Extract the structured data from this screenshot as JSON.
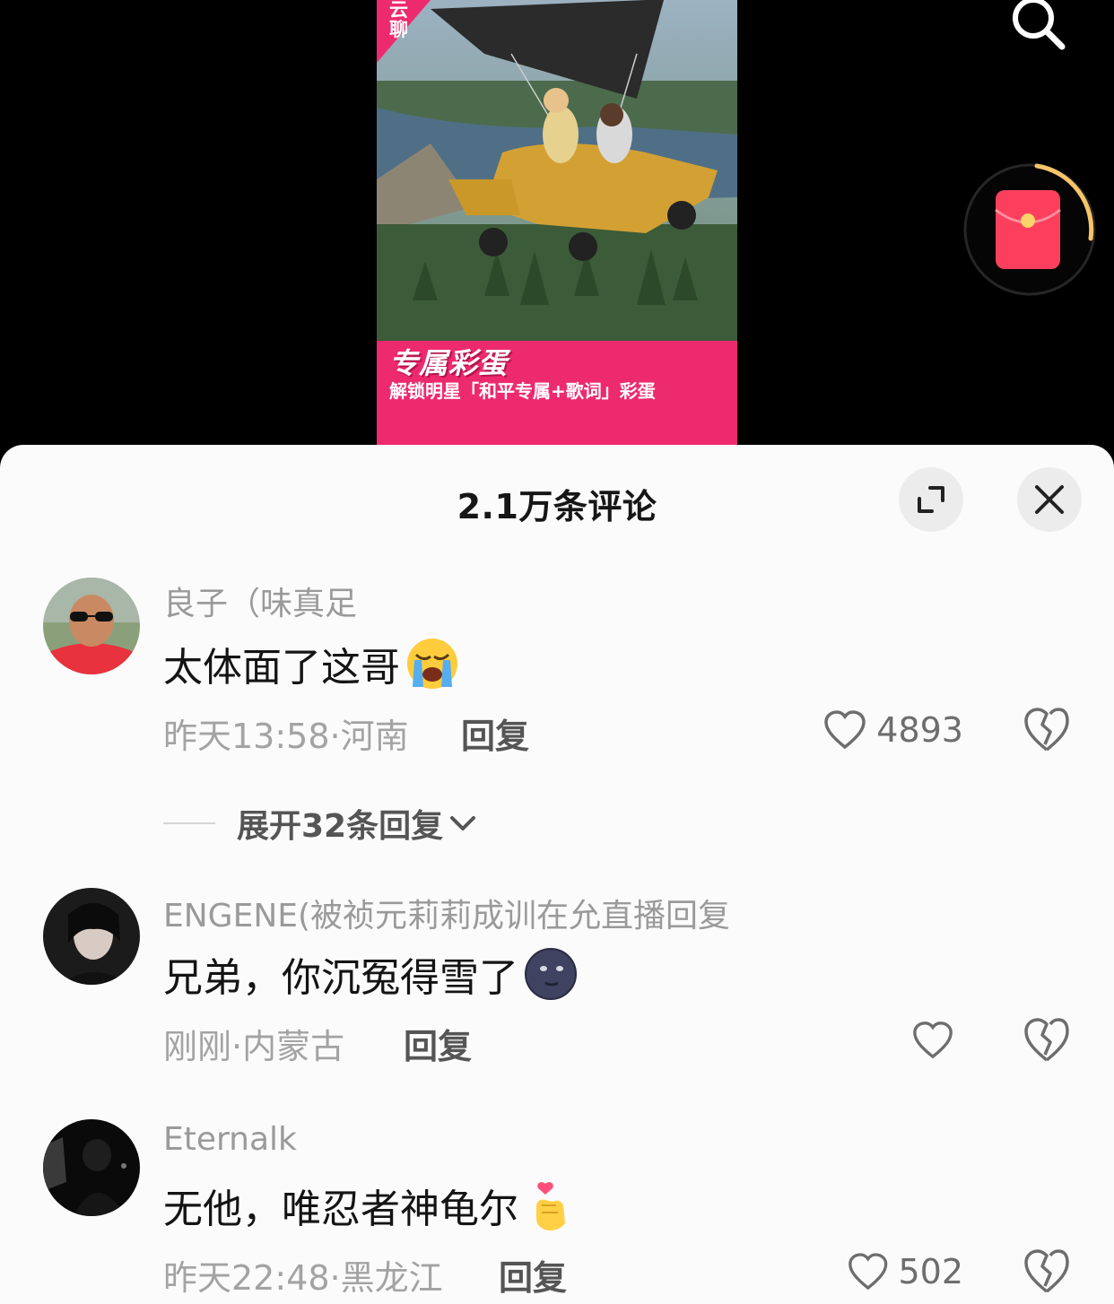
{
  "video": {
    "poster_logo": "云聊",
    "poster_title": "专属彩蛋",
    "poster_subtitle": "解锁明星「和平专属+歌词」彩蛋",
    "search_icon": "search-icon",
    "redpacket_icon": "red-envelope-icon"
  },
  "comments_panel": {
    "title": "2.1万条评论",
    "expand_icon": "expand-icon",
    "close_icon": "close-icon",
    "comments": [
      {
        "username": "良子（味真足",
        "text": "太体面了这哥",
        "emoji": "loudly-crying-face",
        "meta": "昨天13:58·河南",
        "reply_label": "回复",
        "likes": "4893",
        "expand_replies": "展开32条回复"
      },
      {
        "username": "ENGENE(被祯元莉莉成训在允直播回复",
        "text": "兄弟，你沉冤得雪了",
        "emoji": "new-moon-face",
        "meta": "刚刚·内蒙古",
        "reply_label": "回复",
        "likes": ""
      },
      {
        "username": "Eternalk",
        "text": "无他，唯忍者神龟尔",
        "emoji": "hand-with-heart",
        "meta": "昨天22:48·黑龙江",
        "reply_label": "回复",
        "likes": "502"
      }
    ]
  },
  "colors": {
    "poster_pink": "#ee2a6e",
    "sheet_bg": "#fbfbfb",
    "redpacket": "#fc3f5d",
    "progress_ring": "#f6c46b"
  }
}
